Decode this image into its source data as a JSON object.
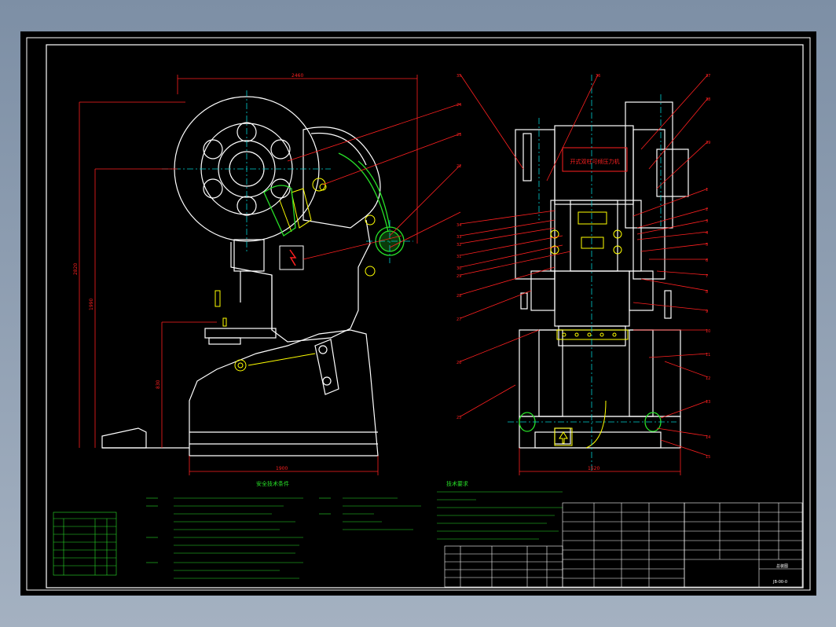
{
  "drawing": {
    "nameplate": "开式双柱可倾压力机",
    "safety_title": "安全技术条件",
    "tech_title": "技术要求",
    "dims": {
      "top_width": "2460",
      "base_width": "1900",
      "front_base_width": "1520",
      "overall_height": "2820",
      "height_2": "1990",
      "height_3": "830"
    },
    "labels_left": [
      "35",
      "34",
      "33",
      "32",
      "31",
      "30",
      "29",
      "28",
      "27",
      "26",
      "25",
      "24",
      "23",
      "22"
    ],
    "labels_right": [
      "37",
      "38",
      "39",
      "1",
      "2",
      "3",
      "4",
      "5",
      "6",
      "7",
      "8",
      "9",
      "10",
      "11",
      "12",
      "13",
      "14",
      "15",
      "16",
      "17",
      "18",
      "19",
      "20",
      "21"
    ],
    "title_block": {
      "drawing_no": "JB-00-0",
      "title": "总装图"
    }
  },
  "colors": {
    "frame": "#ffffff",
    "outline": "#ffffff",
    "center": "#00cfd0",
    "leader": "#ff2020",
    "detail": "#ffff40",
    "dimension": "#ff2020",
    "text_green": "#28e028",
    "part": "#28e028"
  }
}
